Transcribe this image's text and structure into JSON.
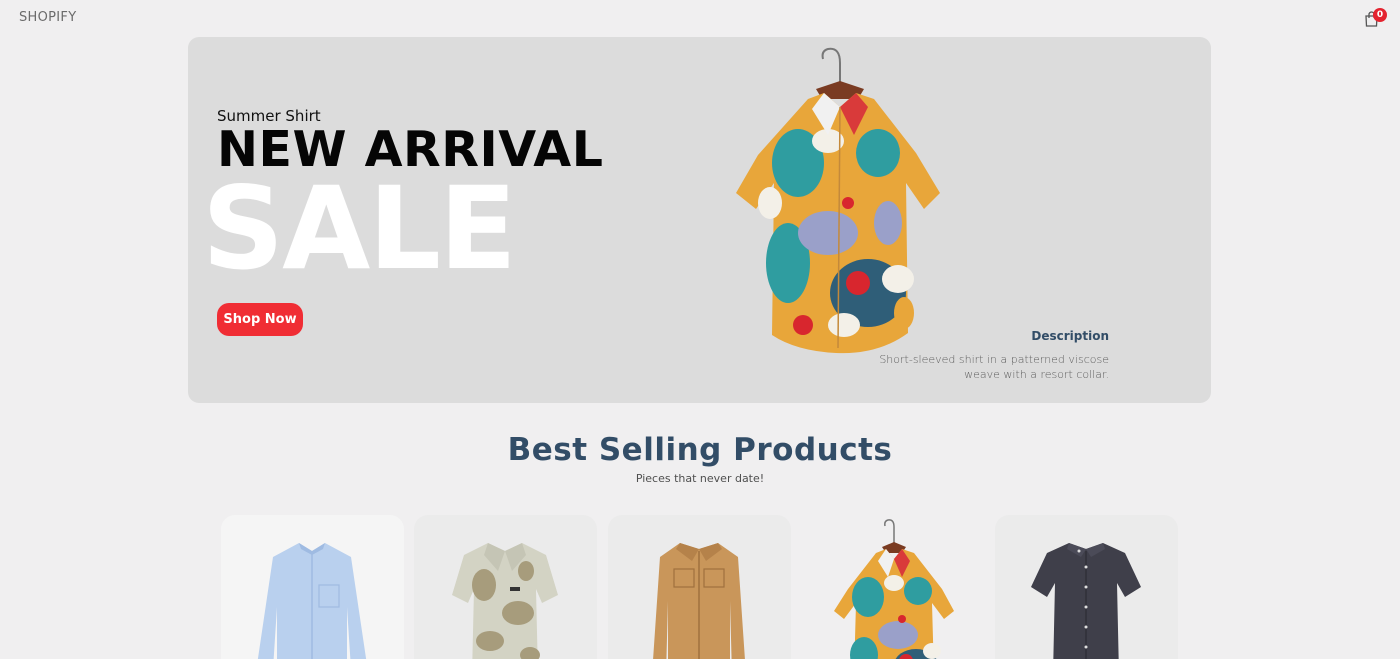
{
  "navbar": {
    "logo": "SHOPIFY",
    "cart_qty": "0",
    "cart_icon": "shopping-bag-icon"
  },
  "hero": {
    "small_text": "Summer Shirt",
    "mid_text": "NEW ARRIVAL",
    "large_text": "SALE",
    "button_label": "Shop Now",
    "image": "printed-shirt-on-hanger",
    "description_title": "Description",
    "description_line1": "Short-sleeved shirt in a patterned viscose",
    "description_line2": "weave with a resort collar."
  },
  "products_section": {
    "title": "Best Selling Products",
    "subtitle": "Pieces that never date!",
    "products": [
      {
        "image": "light-blue-long-sleeve-shirt"
      },
      {
        "image": "beige-map-print-short-sleeve-shirt"
      },
      {
        "image": "tan-overshirt-jacket"
      },
      {
        "image": "printed-shirt-on-hanger"
      },
      {
        "image": "dark-navy-short-sleeve-shirt"
      }
    ]
  },
  "colors": {
    "background": "#f0eff0",
    "hero_background": "#dcdcdc",
    "accent": "#f02d34",
    "heading": "#324d67"
  }
}
